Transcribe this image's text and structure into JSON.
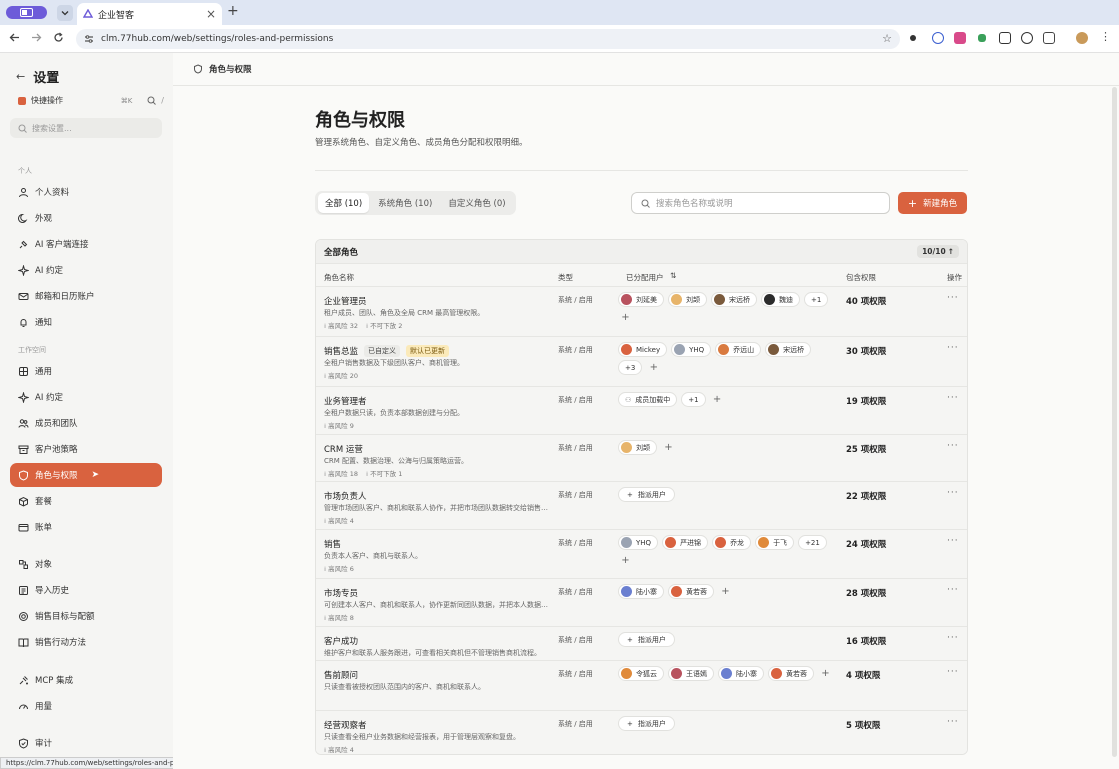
{
  "browser": {
    "tab_title": "企业智客",
    "url": "clm.77hub.com/web/settings/roles-and-permissions",
    "status_url": "https://clm.77hub.com/web/settings/roles-and-permissions"
  },
  "sidebar": {
    "title": "设置",
    "quick_action": "快捷操作",
    "quick_kbd": "⌘K",
    "search_placeholder": "搜索设置...",
    "groups": {
      "personal": "个人",
      "workspace": "工作空间"
    },
    "personal_items": [
      {
        "label": "个人资料",
        "icon": "user-icon"
      },
      {
        "label": "外观",
        "icon": "moon-icon"
      },
      {
        "label": "AI 客户端连接",
        "icon": "plug-icon"
      },
      {
        "label": "AI 约定",
        "icon": "sparkle-icon"
      },
      {
        "label": "邮箱和日历账户",
        "icon": "mail-icon"
      },
      {
        "label": "通知",
        "icon": "bell-icon"
      }
    ],
    "workspace_items": [
      {
        "label": "通用",
        "icon": "grid-icon"
      },
      {
        "label": "AI 约定",
        "icon": "sparkle-icon"
      },
      {
        "label": "成员和团队",
        "icon": "users-icon"
      },
      {
        "label": "客户池策略",
        "icon": "archive-icon"
      },
      {
        "label": "角色与权限",
        "icon": "shield-icon",
        "active": true
      },
      {
        "label": "套餐",
        "icon": "box-icon"
      },
      {
        "label": "账单",
        "icon": "card-icon"
      }
    ],
    "other_items": [
      {
        "label": "对象",
        "icon": "object-icon"
      },
      {
        "label": "导入历史",
        "icon": "history-icon"
      },
      {
        "label": "销售目标与配额",
        "icon": "target-icon"
      },
      {
        "label": "销售行动方法",
        "icon": "book-icon"
      },
      {
        "label": "MCP 集成",
        "icon": "mcp-icon"
      },
      {
        "label": "用量",
        "icon": "gauge-icon"
      },
      {
        "label": "审计",
        "icon": "shield-check-icon"
      }
    ]
  },
  "main": {
    "breadcrumb": "角色与权限",
    "title": "角色与权限",
    "description": "管理系统角色、自定义角色、成员角色分配和权限明细。",
    "filters": [
      "全部 (10)",
      "系统角色 (10)",
      "自定义角色 (0)"
    ],
    "search_placeholder": "搜索角色名称或说明",
    "new_role": "新建角色",
    "table": {
      "title": "全部角色",
      "count": "10/10",
      "columns": [
        "角色名称",
        "类型",
        "已分配用户",
        "包含权限",
        "操作"
      ],
      "assign_label": "指派用户",
      "ops": "···",
      "rows": [
        {
          "name": "企业管理员",
          "badges": [],
          "desc": "租户成员、团队、角色及全局 CRM 最高管理权限。",
          "meta": [
            "高风险 32",
            "不可下放 2"
          ],
          "type": "系统 / 启用",
          "perm": "40 项权限",
          "users": [
            {
              "n": "刘延美",
              "c": "#b8525e"
            },
            {
              "n": "刘颉",
              "c": "#e7b46a"
            },
            {
              "n": "宋远桥",
              "c": "#7a5a3c"
            },
            {
              "n": "魏迪",
              "c": "#2b2b2b"
            }
          ],
          "more": "+1",
          "assign": false
        },
        {
          "name": "销售总监",
          "badges": [
            {
              "t": "已自定义",
              "w": false
            },
            {
              "t": "默认已更新",
              "w": true
            }
          ],
          "desc": "全租户销售数据及下级团队客户、商机管理。",
          "meta": [
            "高风险 20"
          ],
          "type": "系统 / 启用",
          "perm": "30 项权限",
          "users": [
            {
              "n": "Mickey",
              "c": "#d9623f"
            },
            {
              "n": "YHQ",
              "c": "#9aa3b2"
            },
            {
              "n": "乔远山",
              "c": "#d97a3f"
            },
            {
              "n": "宋远桥",
              "c": "#7a5a3c"
            }
          ],
          "more": "+3",
          "assign": false
        },
        {
          "name": "业务管理者",
          "badges": [],
          "desc": "全租户数据只读，负责本部数据创建与分配。",
          "meta": [
            "高风险 9"
          ],
          "type": "系统 / 启用",
          "perm": "19 项权限",
          "users": [
            {
              "n": "成员加载中",
              "c": ""
            }
          ],
          "more": "+1",
          "assign": false
        },
        {
          "name": "CRM 运营",
          "badges": [],
          "desc": "CRM 配置、数据治理、公海与归属策略运营。",
          "meta": [
            "高风险 18",
            "不可下放 1"
          ],
          "type": "系统 / 启用",
          "perm": "25 项权限",
          "users": [
            {
              "n": "刘颉",
              "c": "#e7b46a"
            }
          ],
          "more": "",
          "assign": false
        },
        {
          "name": "市场负责人",
          "badges": [],
          "desc": "管理市场团队客户、商机和联系人协作，并把市场团队数据转交给销售团队。",
          "meta": [
            "高风险 4"
          ],
          "type": "系统 / 启用",
          "perm": "22 项权限",
          "users": [],
          "more": "",
          "assign": true
        },
        {
          "name": "销售",
          "badges": [],
          "desc": "负责本人客户、商机与联系人。",
          "meta": [
            "高风险 6"
          ],
          "type": "系统 / 启用",
          "perm": "24 项权限",
          "users": [
            {
              "n": "YHQ",
              "c": "#9aa3b2"
            },
            {
              "n": "严进锦",
              "c": "#d9623f"
            },
            {
              "n": "乔龙",
              "c": "#d9623f"
            },
            {
              "n": "于飞",
              "c": "#e08a3a"
            }
          ],
          "more": "+21",
          "assign": false
        },
        {
          "name": "市场专员",
          "badges": [],
          "desc": "可创建本人客户、商机和联系人，协作更新同团队数据，并把本人数据转交。",
          "meta": [
            "高风险 8"
          ],
          "type": "系统 / 启用",
          "perm": "28 项权限",
          "users": [
            {
              "n": "陆小寨",
              "c": "#6a7fd0"
            },
            {
              "n": "黄若蓉",
              "c": "#d9623f"
            }
          ],
          "more": "",
          "assign": false
        },
        {
          "name": "客户成功",
          "badges": [],
          "desc": "维护客户和联系人服务跟进，可查看相关商机但不管理销售商机流程。",
          "meta": [],
          "type": "系统 / 启用",
          "perm": "16 项权限",
          "users": [],
          "more": "",
          "assign": true
        },
        {
          "name": "售前顾问",
          "badges": [],
          "desc": "只读查看被授权团队范围内的客户、商机和联系人。",
          "meta": [],
          "type": "系统 / 启用",
          "perm": "4 项权限",
          "users": [
            {
              "n": "令狐云",
              "c": "#e08a3a"
            },
            {
              "n": "王语嫣",
              "c": "#b8525e"
            },
            {
              "n": "陆小寨",
              "c": "#6a7fd0"
            },
            {
              "n": "黄若蓉",
              "c": "#d9623f"
            }
          ],
          "more": "",
          "assign": false
        },
        {
          "name": "经营观察者",
          "badges": [],
          "desc": "只读查看全租户业务数据和经营报表，用于管理层观察和复盘。",
          "meta": [
            "高风险 4"
          ],
          "type": "系统 / 启用",
          "perm": "5 项权限",
          "users": [],
          "more": "",
          "assign": true
        }
      ]
    }
  }
}
